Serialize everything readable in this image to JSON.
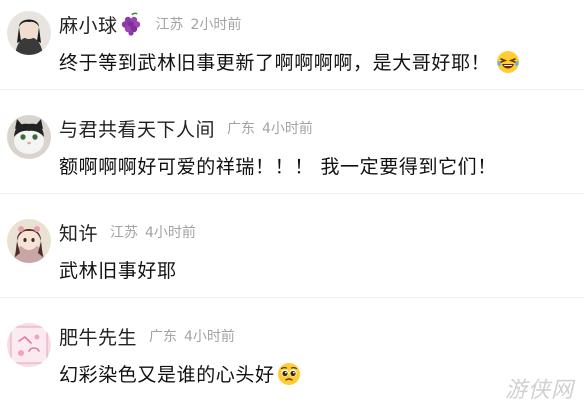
{
  "comments": [
    {
      "username": "麻小球",
      "region": "江苏",
      "time": "2小时前",
      "text": "终于等到武林旧事更新了啊啊啊啊，是大哥好耶！",
      "name_emoji": "grape-icon",
      "text_emoji": "laughing-crying-face-icon"
    },
    {
      "username": "与君共看天下人间",
      "region": "广东",
      "time": "4小时前",
      "text": "额啊啊啊好可爱的祥瑞！！！ 我一定要得到它们！"
    },
    {
      "username": "知许",
      "region": "江苏",
      "time": "4小时前",
      "text": "武林旧事好耶"
    },
    {
      "username": "肥牛先生",
      "region": "广东",
      "time": "4小时前",
      "text": "幻彩染色又是谁的心头好",
      "text_emoji": "pleading-face-icon"
    }
  ],
  "watermark": "游侠网"
}
